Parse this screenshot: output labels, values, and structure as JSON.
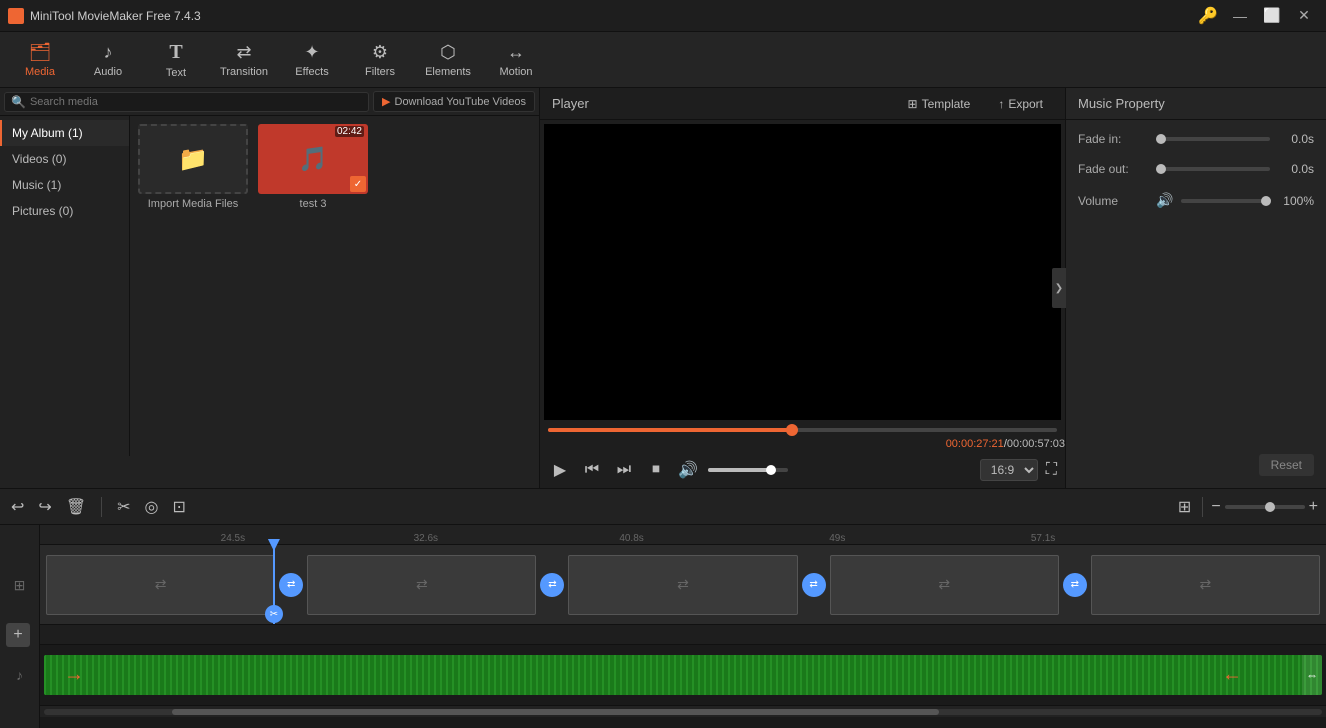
{
  "app": {
    "title": "MiniTool MovieMaker Free 7.4.3",
    "key_icon": "🔑"
  },
  "titlebar": {
    "title": "MiniTool MovieMaker Free 7.4.3",
    "minimize": "—",
    "maximize": "⬜",
    "close": "✕"
  },
  "toolbar": {
    "items": [
      {
        "id": "media",
        "label": "Media",
        "icon": "🗂",
        "active": true
      },
      {
        "id": "audio",
        "label": "Audio",
        "icon": "🎵",
        "active": false
      },
      {
        "id": "text",
        "label": "Text",
        "icon": "T",
        "active": false
      },
      {
        "id": "transition",
        "label": "Transition",
        "icon": "⇄",
        "active": false
      },
      {
        "id": "effects",
        "label": "Effects",
        "icon": "✦",
        "active": false
      },
      {
        "id": "filters",
        "label": "Filters",
        "icon": "⚙",
        "active": false
      },
      {
        "id": "elements",
        "label": "Elements",
        "icon": "⬡",
        "active": false
      },
      {
        "id": "motion",
        "label": "Motion",
        "icon": "↔",
        "active": false
      }
    ]
  },
  "sidebar": {
    "albums": [
      {
        "label": "My Album (1)",
        "active": true
      },
      {
        "label": "Videos (0)",
        "active": false
      },
      {
        "label": "Music (1)",
        "active": false
      },
      {
        "label": "Pictures (0)",
        "active": false
      }
    ]
  },
  "media_toolbar": {
    "search_placeholder": "Search media",
    "yt_label": "Download YouTube Videos"
  },
  "media_items": [
    {
      "type": "import",
      "label": "Import Media Files"
    },
    {
      "type": "music",
      "label": "test 3",
      "duration": "02:42",
      "checked": true
    }
  ],
  "player": {
    "title": "Player",
    "template_label": "Template",
    "export_label": "Export",
    "time_current": "00:00:27:21",
    "time_separator": " / ",
    "time_total": "00:00:57:03",
    "progress_pct": 48,
    "volume_pct": 75,
    "aspect_ratio": "16:9"
  },
  "music_property": {
    "title": "Music Property",
    "fade_in_label": "Fade in:",
    "fade_in_value": "0.0s",
    "fade_out_label": "Fade out:",
    "fade_out_value": "0.0s",
    "volume_label": "Volume",
    "volume_value": "100%",
    "reset_label": "Reset"
  },
  "timeline": {
    "ruler_marks": [
      "24.5s",
      "32.6s",
      "40.8s",
      "49s",
      "57.1s"
    ],
    "undo_icon": "↩",
    "redo_icon": "↪",
    "delete_icon": "🗑",
    "cut_icon": "✂",
    "detach_icon": "◎",
    "crop_icon": "⊡",
    "zoom_minus": "−",
    "zoom_plus": "+"
  }
}
